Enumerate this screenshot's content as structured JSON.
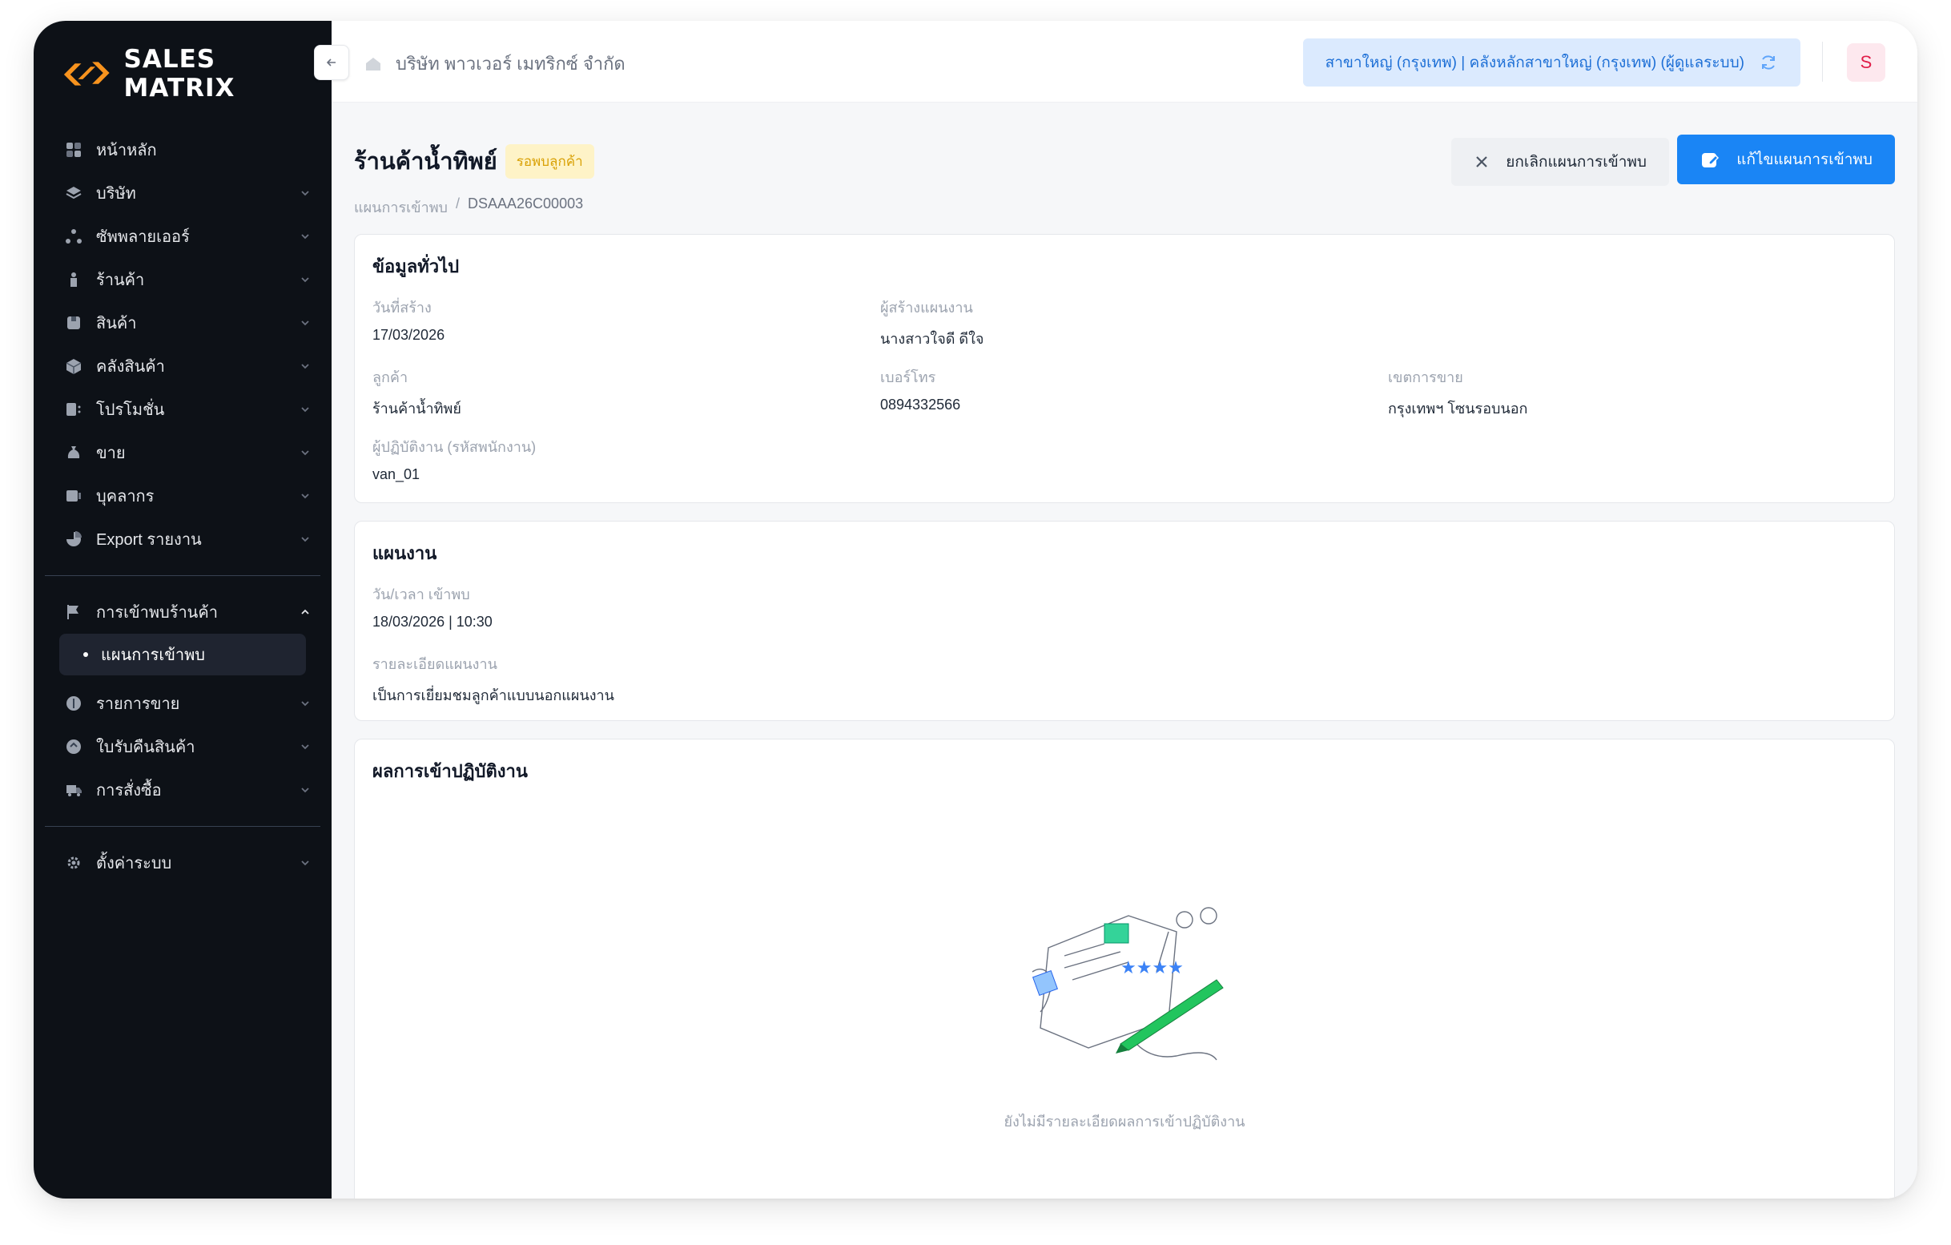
{
  "brand": {
    "name": "SALES MATRIX"
  },
  "sidebar": {
    "items": [
      {
        "label": "หน้าหลัก",
        "icon": "dashboard-icon",
        "has_children": false
      },
      {
        "label": "บริษัท",
        "icon": "layers-icon",
        "has_children": true
      },
      {
        "label": "ซัพพลายเออร์",
        "icon": "network-icon",
        "has_children": true
      },
      {
        "label": "ร้านค้า",
        "icon": "store-icon",
        "has_children": true
      },
      {
        "label": "สินค้า",
        "icon": "product-icon",
        "has_children": true
      },
      {
        "label": "คลังสินค้า",
        "icon": "box-icon",
        "has_children": true
      },
      {
        "label": "โปรโมชั่น",
        "icon": "promo-icon",
        "has_children": true
      },
      {
        "label": "ขาย",
        "icon": "money-bag-icon",
        "has_children": true
      },
      {
        "label": "บุคลากร",
        "icon": "id-card-icon",
        "has_children": true
      },
      {
        "label": "Export รายงาน",
        "icon": "pie-chart-icon",
        "has_children": true
      }
    ],
    "visit_group": {
      "label": "การเข้าพบร้านค้า",
      "icon": "flag-icon",
      "sub_items": [
        {
          "label": "แผนการเข้าพบ",
          "active": true
        }
      ]
    },
    "items2": [
      {
        "label": "รายการขาย",
        "icon": "receipt-icon",
        "has_children": true
      },
      {
        "label": "ใบรับคืนสินค้า",
        "icon": "return-icon",
        "has_children": true
      },
      {
        "label": "การสั่งซื้อ",
        "icon": "truck-icon",
        "has_children": true
      }
    ],
    "settings": {
      "label": "ตั้งค่าระบบ",
      "icon": "gear-icon"
    }
  },
  "topbar": {
    "company": "บริษัท พาวเวอร์ เมทริกซ์ จำกัด",
    "branch": "สาขาใหญ่ (กรุงเทพ) | คลังหลักสาขาใหญ่ (กรุงเทพ) (ผู้ดูแลระบบ)",
    "avatar_initial": "S"
  },
  "page": {
    "title": "ร้านค้าน้ำทิพย์",
    "status": "รอพบลูกค้า",
    "breadcrumb": [
      "แผนการเข้าพบ",
      "/",
      "DSAAA26C00003"
    ],
    "cancel_label": "ยกเลิกแผนการเข้าพบ",
    "edit_label": "แก้ไขแผนการเข้าพบ"
  },
  "general": {
    "title": "ข้อมูลทั่วไป",
    "created_date_label": "วันที่สร้าง",
    "created_date": "17/03/2026",
    "creator_label": "ผู้สร้างแผนงาน",
    "creator": "นางสาวใจดี ดีใจ",
    "customer_label": "ลูกค้า",
    "customer": "ร้านค้าน้ำทิพย์",
    "phone_label": "เบอร์โทร",
    "phone": "0894332566",
    "zone_label": "เขตการขาย",
    "zone": "กรุงเทพฯ โซนรอบนอก",
    "operator_label": "ผู้ปฏิบัติงาน (รหัสพนักงาน)",
    "operator": "van_01"
  },
  "plan": {
    "title": "แผนงาน",
    "datetime_label": "วัน/เวลา เข้าพบ",
    "datetime": "18/03/2026 | 10:30",
    "detail_label": "รายละเอียดแผนงาน",
    "detail": "เป็นการเยี่ยมชมลูกค้าแบบนอกแผนงาน"
  },
  "result": {
    "title": "ผลการเข้าปฏิบัติงาน",
    "empty_text": "ยังไม่มีรายละเอียดผลการเข้าปฏิบัติงาน"
  },
  "colors": {
    "sidebar_bg": "#0d1117",
    "accent_blue": "#1a85f5",
    "status_yellow": "#d9a106",
    "brand_orange": "#f7931e"
  }
}
